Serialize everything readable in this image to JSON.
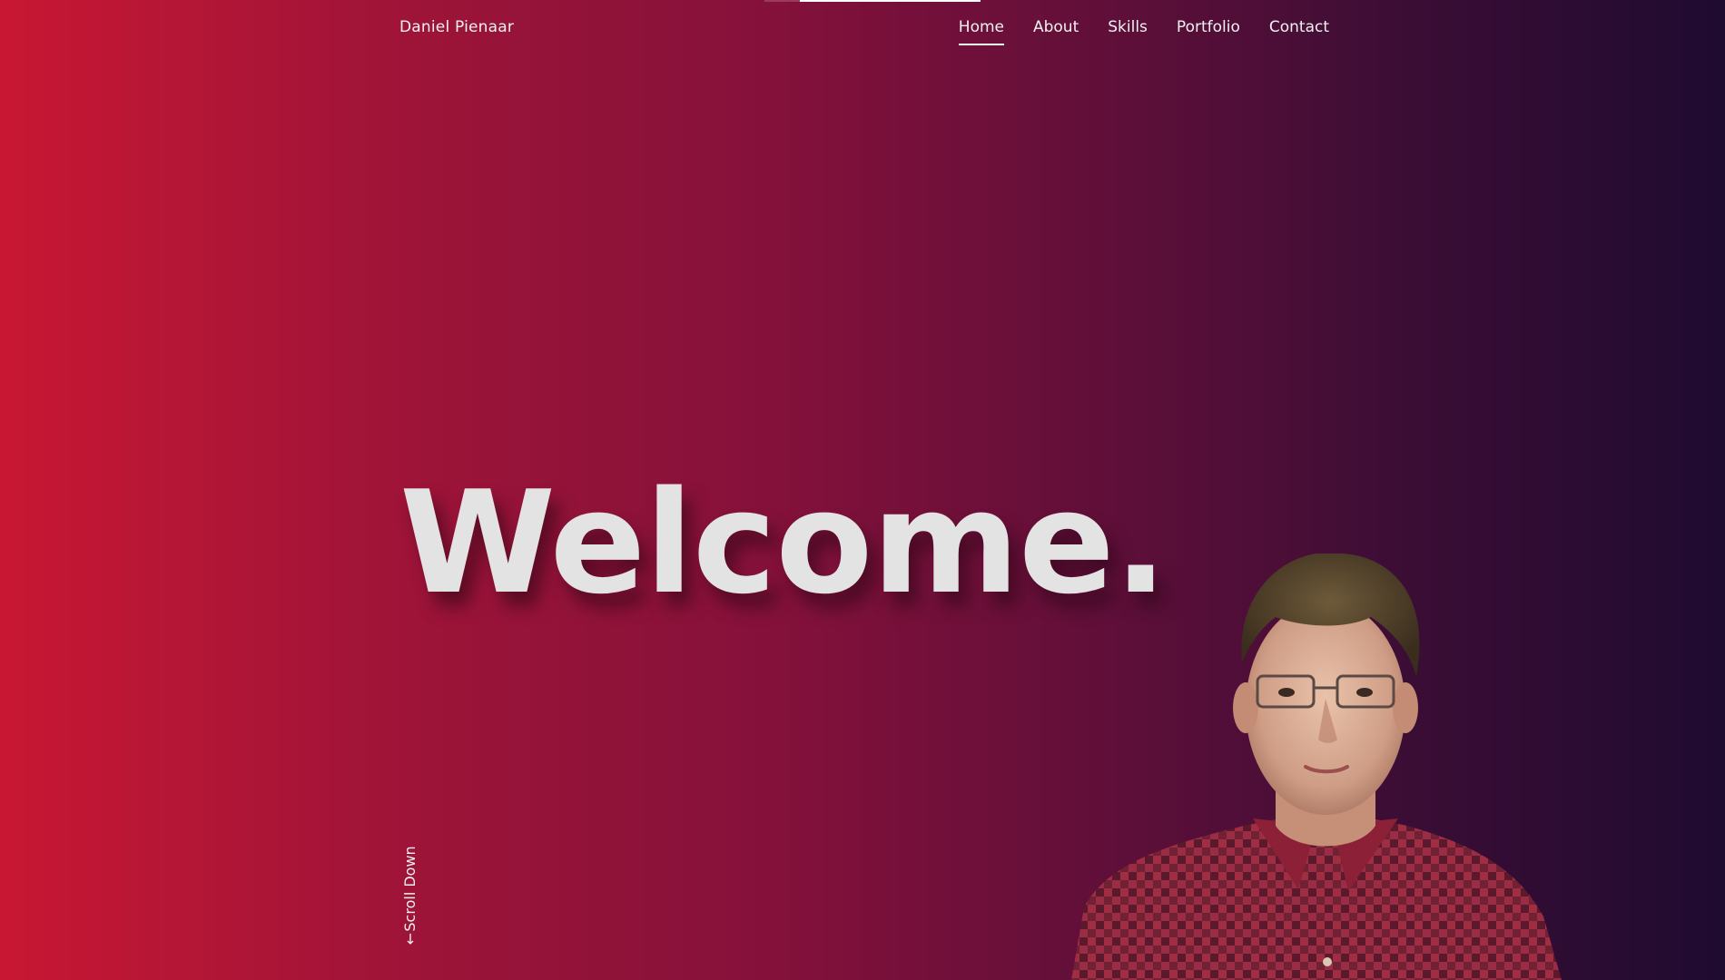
{
  "nav": {
    "brand": "Daniel Pienaar",
    "links": [
      {
        "label": "Home",
        "active": true
      },
      {
        "label": "About",
        "active": false
      },
      {
        "label": "Skills",
        "active": false
      },
      {
        "label": "Portfolio",
        "active": false
      },
      {
        "label": "Contact",
        "active": false
      }
    ]
  },
  "hero": {
    "headline": "Welcome.",
    "scroll_label": "Scroll Down",
    "scroll_arrow": "↓"
  },
  "icons": {
    "scroll_arrow": "arrow-down-icon"
  },
  "colors": {
    "gradient_start": "#c81733",
    "gradient_end": "#1f0b30",
    "text": "#f2f2f2",
    "headline": "#e3e3e3"
  }
}
